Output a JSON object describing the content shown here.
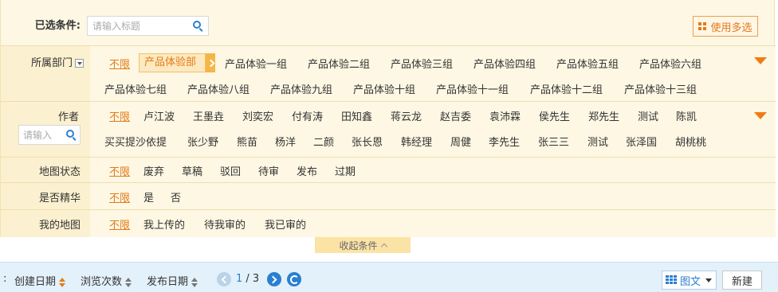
{
  "selected": {
    "label": "已选条件:",
    "search_placeholder": "请输入标题",
    "multi_select_label": "使用多选"
  },
  "filters": {
    "department": {
      "label": "所属部门",
      "unlimited": "不限",
      "selected": "产品体验部",
      "options": [
        "产品体验一组",
        "产品体验二组",
        "产品体验三组",
        "产品体验四组",
        "产品体验五组",
        "产品体验六组",
        "产品体验七组",
        "产品体验八组",
        "产品体验九组",
        "产品体验十组",
        "产品体验十一组",
        "产品体验十二组",
        "产品体验十三组"
      ]
    },
    "author": {
      "label": "作者",
      "search_placeholder": "请输入",
      "unlimited": "不限",
      "options": [
        "卢江波",
        "王墨垚",
        "刘奕宏",
        "付有涛",
        "田知鑫",
        "蒋云龙",
        "赵吉委",
        "袁沛霖",
        "侯先生",
        "郑先生",
        "测试",
        "陈凯",
        "买买提沙依提",
        "张少野",
        "熊苗",
        "杨洋",
        "二颜",
        "张长恩",
        "韩经理",
        "周健",
        "李先生",
        "张三三",
        "测试",
        "张泽国",
        "胡桃桃"
      ]
    },
    "map_status": {
      "label": "地图状态",
      "unlimited": "不限",
      "options": [
        "废弃",
        "草稿",
        "驳回",
        "待审",
        "发布",
        "过期"
      ]
    },
    "essence": {
      "label": "是否精华",
      "unlimited": "不限",
      "options": [
        "是",
        "否"
      ]
    },
    "my_maps": {
      "label": "我的地图",
      "unlimited": "不限",
      "options": [
        "我上传的",
        "待我审的",
        "我已审的"
      ]
    }
  },
  "collapse_label": "收起条件",
  "toolbar": {
    "prefix": ":",
    "sort_created": "创建日期",
    "sort_views": "浏览次数",
    "sort_published": "发布日期",
    "page_current": "1",
    "page_sep": " / 3",
    "view_mode": "图文",
    "new_label": "新建"
  },
  "colors": {
    "accent_orange": "#e27b19",
    "accent_blue": "#2a7fd0",
    "panel_bg": "#fdf7e3",
    "toolbar_bg": "#e3f1fb"
  }
}
